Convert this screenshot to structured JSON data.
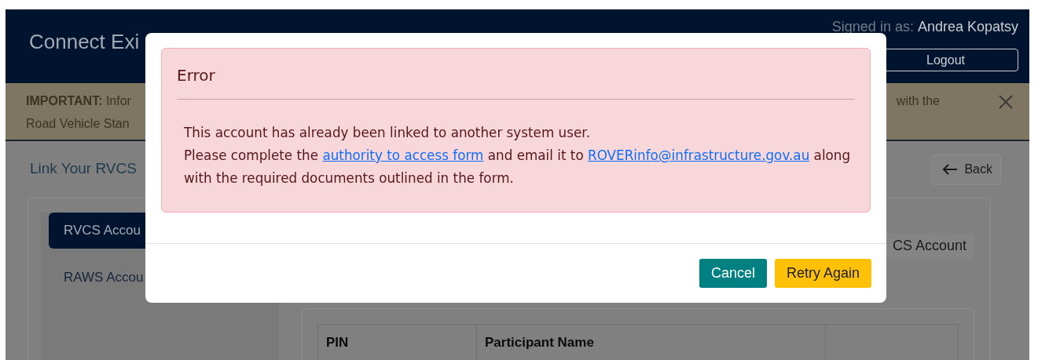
{
  "header": {
    "title": "Connect Exi",
    "signed_in_label": "Signed in as:",
    "user_name": "Andrea Kopatsy",
    "logout": "Logout"
  },
  "banner": {
    "label": "IMPORTANT:",
    "line_1_start": "Infor",
    "line_1_end": "with the",
    "line_2_start": "Road Vehicle Stan"
  },
  "page": {
    "heading": "Link Your RVCS",
    "back": "Back"
  },
  "tabs": [
    {
      "label": "RVCS Accou",
      "selected": true
    },
    {
      "label": "RAWS Accou",
      "selected": false
    }
  ],
  "add_button": "CS Account",
  "table": {
    "columns": [
      "PIN",
      "Participant Name"
    ]
  },
  "dialog": {
    "title": "Error",
    "line_1": "This account has already been linked to another system user.",
    "text_before": "Please complete the ",
    "link_1": "authority to access form",
    "text_mid": " and email it to ",
    "link_2": "ROVERinfo@infrastructure.gov.au",
    "text_after": " along with the required documents outlined in the form.",
    "buttons": [
      {
        "label": "Cancel",
        "kind": "secondary"
      },
      {
        "label": "Retry Again",
        "kind": "primary"
      }
    ]
  }
}
